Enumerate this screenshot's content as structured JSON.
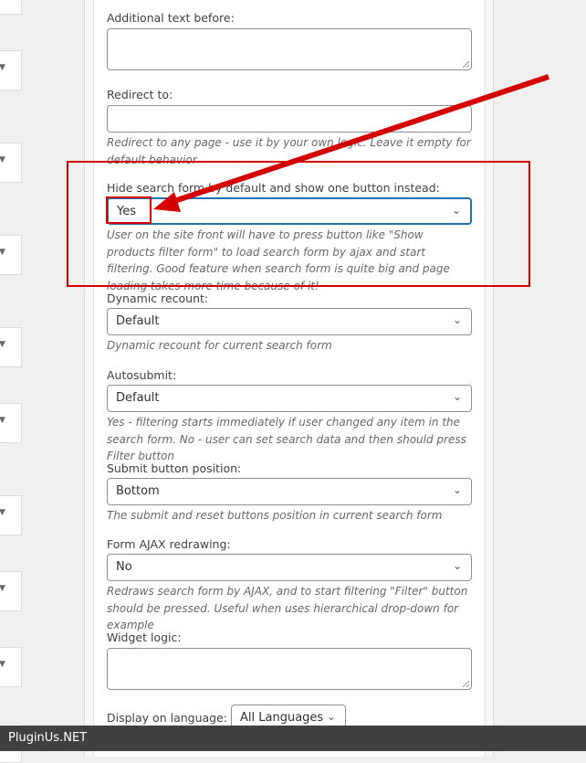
{
  "fields": {
    "additional_text_before": {
      "label": "Additional text before:"
    },
    "redirect_to": {
      "label": "Redirect to:",
      "description": "Redirect to any page - use it by your own logic. Leave it empty for default behavior"
    },
    "hide_search_form": {
      "label": "Hide search form by default and show one button instead:",
      "value": "Yes",
      "description": "User on the site front will have to press button like \"Show products filter form\" to load search form by ajax and start filtering. Good feature when search form is quite big and page loading takes more time because of it!"
    },
    "dynamic_recount": {
      "label": "Dynamic recount:",
      "value": "Default",
      "description": "Dynamic recount for current search form"
    },
    "autosubmit": {
      "label": "Autosubmit:",
      "value": "Default",
      "description": "Yes - filtering starts immediately if user changed any item in the search form. No - user can set search data and then should press Filter button"
    },
    "submit_button_position": {
      "label": "Submit button position:",
      "value": "Bottom",
      "description": "The submit and reset buttons position in current search form"
    },
    "form_ajax_redrawing": {
      "label": "Form AJAX redrawing:",
      "value": "No",
      "description": "Redraws search form by AJAX, and to start filtering \"Filter\" button should be pressed. Useful when uses hierarchical drop-down for example"
    },
    "widget_logic": {
      "label": "Widget logic:"
    },
    "display_on_language": {
      "label": "Display on language:",
      "value": "All Languages"
    }
  },
  "watermark": "PluginUs.NET",
  "annotation_color": "#d40000"
}
